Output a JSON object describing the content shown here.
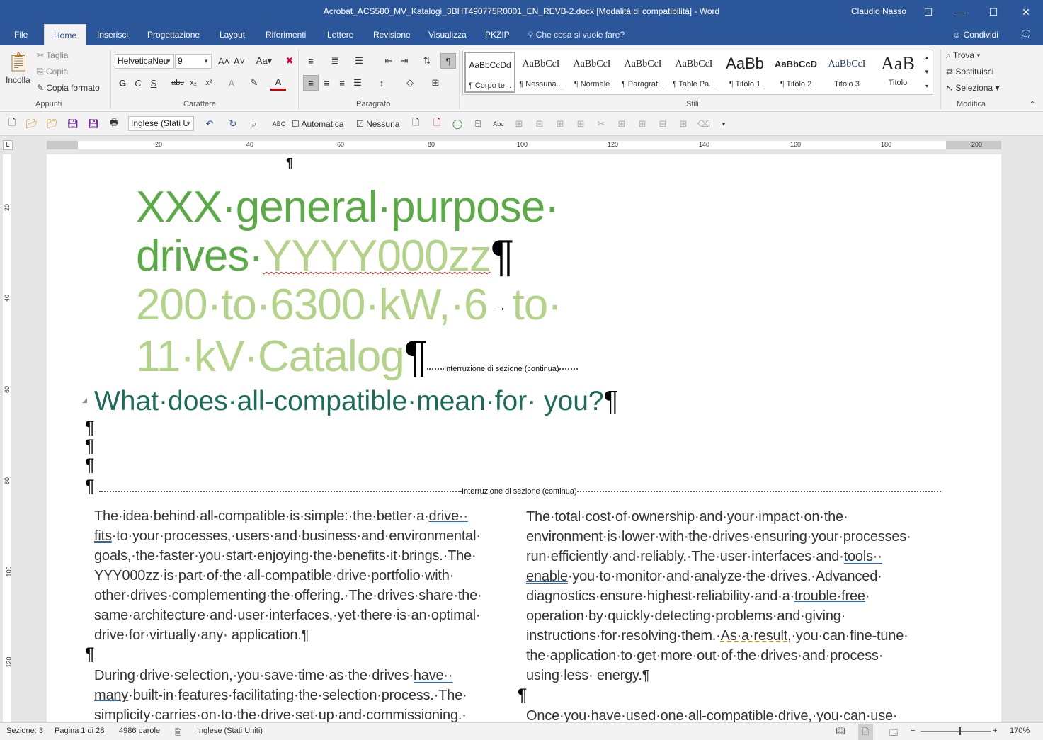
{
  "window": {
    "title": "Acrobat_ACS580_MV_Katalogi_3BHT490775R0001_EN_REVB-2.docx [Modalità di compatibilità]  -  Word",
    "user": "Claudio Nasso"
  },
  "tabs": [
    "File",
    "Home",
    "Inserisci",
    "Progettazione",
    "Layout",
    "Riferimenti",
    "Lettere",
    "Revisione",
    "Visualizza",
    "PKZIP"
  ],
  "tell_me": "Che cosa si vuole fare?",
  "share": "Condividi",
  "ribbon": {
    "clipboard": {
      "paste": "Incolla",
      "cut": "Taglia",
      "copy": "Copia",
      "format_painter": "Copia formato",
      "label": "Appunti"
    },
    "font": {
      "name": "HelveticaNeu",
      "size": "9",
      "label": "Carattere"
    },
    "paragraph": {
      "label": "Paragrafo"
    },
    "styles": {
      "label": "Stili",
      "items": [
        {
          "sample": "AaBbCcDd",
          "name": "¶ Corpo te..."
        },
        {
          "sample": "AaBbCcI",
          "name": "¶ Nessuna..."
        },
        {
          "sample": "AaBbCcI",
          "name": "¶ Normale"
        },
        {
          "sample": "AaBbCcI",
          "name": "¶ Paragraf..."
        },
        {
          "sample": "AaBbCcI",
          "name": "¶ Table Pa..."
        },
        {
          "sample": "AaBb",
          "name": "¶ Titolo 1"
        },
        {
          "sample": "AaBbCcD",
          "name": "¶ Titolo 2"
        },
        {
          "sample": "AaBbCcI",
          "name": "Titolo 3"
        },
        {
          "sample": "AaB",
          "name": "Titolo"
        }
      ]
    },
    "editing": {
      "find": "Trova",
      "replace": "Sostituisci",
      "select": "Seleziona",
      "label": "Modifica"
    }
  },
  "qat": {
    "language": "Inglese (Stati U",
    "automatic": "Automatica",
    "none": "Nessuna"
  },
  "ruler_numbers": [
    "20",
    "40",
    "60",
    "80",
    "100",
    "120",
    "140",
    "160",
    "180",
    "200"
  ],
  "vruler_numbers": [
    "20",
    "40",
    "60",
    "80",
    "100",
    "120"
  ],
  "document": {
    "title_line1": "XXX·general·purpose·",
    "title_line2a": "drives·",
    "title_line2b": "YYYY000zz",
    "title_line3": "200·to·6300·kW,·6",
    "title_line3b": "to·",
    "title_line4": "11·kV·Catalog",
    "section_break": "Interruzione di sezione (continua)",
    "heading": "What·does·all-compatible·mean·for· you?",
    "pilcrow": "¶",
    "col1_p1": [
      "The·idea·behind·all-compatible·is·simple:·the·better·a·",
      "drive··",
      "fits",
      "·to·your·processes,·users·and·business·and·environmental·",
      "goals,·the·faster·you·start·enjoying·the·benefits·it·brings.·The·",
      "YYY000zz·is·part·of·the·all-compatible·drive·portfolio·with·",
      "other·drives·complementing·the·offering.·The·drives·share·the·",
      "same·architecture·and·user·interfaces,·yet·there·is·an·optimal·",
      "drive·for·virtually·any· application.¶"
    ],
    "col1_p2": [
      "During·drive·selection,·you·save·time·as·the·drives·",
      "have··",
      "many",
      "·built-in·features·facilitating·the·selection·process.·The·",
      "simplicity·carries·on·to·the·drive·set·up·and·commissioning.·"
    ],
    "col2_p1": [
      "The·total·cost·of·ownership·and·your·impact·on·the·",
      "environment·is·lower·with·the·drives·ensuring·your·processes·",
      "run·efficiently·and·reliably.·The·user·interfaces·and·",
      "tools··",
      "enable",
      "·you·to·monitor·and·analyze·the·drives.·Advanced·",
      "diagnostics·ensure·highest·reliability·and·a·",
      "trouble·free",
      "·",
      "operation·by·quickly·detecting·problems·and·giving·",
      "instructions·for·resolving·them.·",
      "As·a·result",
      ",·you·can·fine-tune·",
      "the·application·to·get·more·out·of·the·drives·and·process·",
      "using·less· energy.¶"
    ],
    "col2_p2": "Once·you·have·used·one·all-compatible·drive,·you·can·use·"
  },
  "status": {
    "section": "Sezione: 3",
    "page": "Pagina 1 di 28",
    "words": "4986 parole",
    "language": "Inglese (Stati Uniti)",
    "zoom": "170%"
  }
}
